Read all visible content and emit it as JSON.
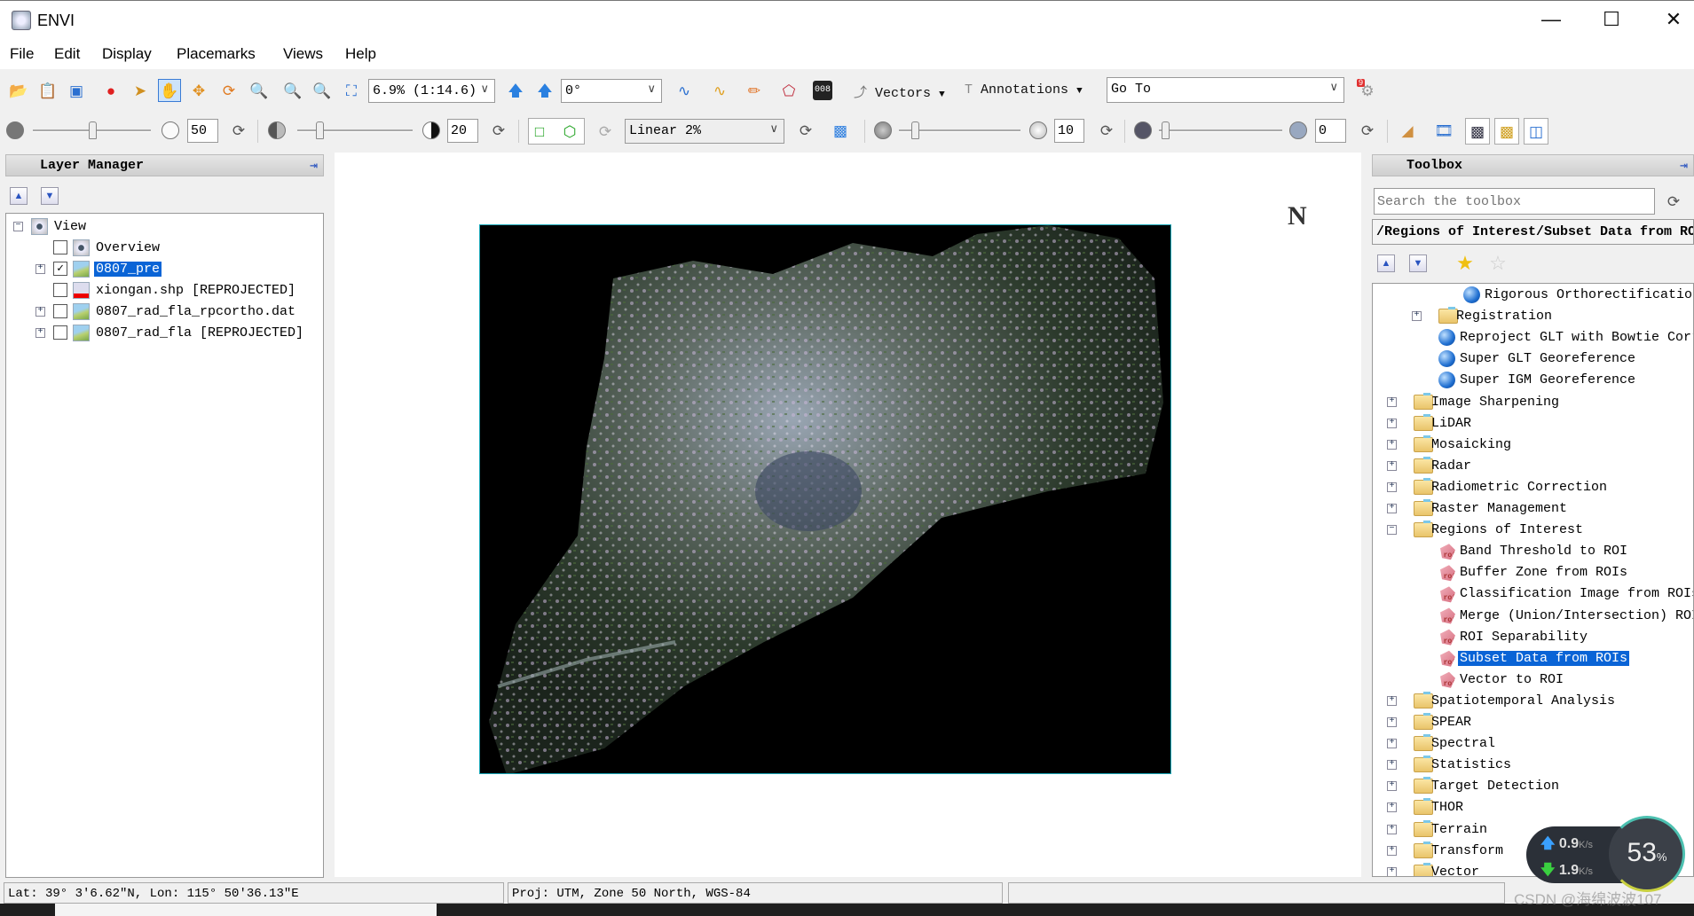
{
  "window": {
    "title": "ENVI",
    "minimize_icon": "minimize-icon",
    "maximize_icon": "maximize-icon",
    "close_icon": "close-icon"
  },
  "menu": [
    "File",
    "Edit",
    "Display",
    "Placemarks",
    "Views",
    "Help"
  ],
  "toolbar1": {
    "zoom_value": "6.9% (1:14.6)",
    "rotation_value": "0°",
    "vectors_label": "Vectors",
    "annotations_label": "Annotations",
    "goto_placeholder": "Go To",
    "notification_count": "9"
  },
  "toolbar2": {
    "brightness_value": "50",
    "contrast_value": "20",
    "stretch_value": "Linear 2%",
    "sharpen_value": "10",
    "transparency_value": "0"
  },
  "layer_manager": {
    "title": "Layer Manager",
    "tree": [
      {
        "label": "View",
        "level": 0,
        "expander": "minus",
        "icon": "view",
        "checkbox": null
      },
      {
        "label": "Overview",
        "level": 1,
        "expander": null,
        "icon": "view",
        "checkbox": false
      },
      {
        "label": "0807_pre",
        "level": 1,
        "expander": "plus",
        "icon": "raster",
        "checkbox": true,
        "selected": true
      },
      {
        "label": "xiongan.shp [REPROJECTED]",
        "level": 1,
        "expander": null,
        "icon": "vector",
        "checkbox": false
      },
      {
        "label": "0807_rad_fla_rpcortho.dat",
        "level": 1,
        "expander": "plus",
        "icon": "raster",
        "checkbox": false
      },
      {
        "label": "0807_rad_fla [REPROJECTED]",
        "level": 1,
        "expander": "plus",
        "icon": "raster",
        "checkbox": false
      }
    ]
  },
  "view": {
    "north_arrow_label": "N"
  },
  "toolbox": {
    "title": "Toolbox",
    "search_placeholder": "Search the toolbox",
    "path": "/Regions of Interest/Subset Data from ROIs",
    "tree": [
      {
        "label": "Rigorous Orthorectification",
        "level": 3,
        "icon": "tool"
      },
      {
        "label": "Registration",
        "level": 2,
        "icon": "folder",
        "expander": "plus"
      },
      {
        "label": "Reproject GLT with Bowtie Correction",
        "level": 2,
        "icon": "tool"
      },
      {
        "label": "Super GLT Georeference",
        "level": 2,
        "icon": "tool"
      },
      {
        "label": "Super IGM Georeference",
        "level": 2,
        "icon": "tool"
      },
      {
        "label": "Image Sharpening",
        "level": 1,
        "icon": "folder",
        "expander": "plus"
      },
      {
        "label": "LiDAR",
        "level": 1,
        "icon": "folder",
        "expander": "plus"
      },
      {
        "label": "Mosaicking",
        "level": 1,
        "icon": "folder",
        "expander": "plus"
      },
      {
        "label": "Radar",
        "level": 1,
        "icon": "folder",
        "expander": "plus"
      },
      {
        "label": "Radiometric Correction",
        "level": 1,
        "icon": "folder",
        "expander": "plus"
      },
      {
        "label": "Raster Management",
        "level": 1,
        "icon": "folder",
        "expander": "plus"
      },
      {
        "label": "Regions of Interest",
        "level": 1,
        "icon": "folder",
        "expander": "minus"
      },
      {
        "label": "Band Threshold to ROI",
        "level": 2,
        "icon": "roi"
      },
      {
        "label": "Buffer Zone from ROIs",
        "level": 2,
        "icon": "roi"
      },
      {
        "label": "Classification Image from ROIs",
        "level": 2,
        "icon": "roi"
      },
      {
        "label": "Merge (Union/Intersection) ROIs",
        "level": 2,
        "icon": "roi"
      },
      {
        "label": "ROI Separability",
        "level": 2,
        "icon": "roi"
      },
      {
        "label": "Subset Data from ROIs",
        "level": 2,
        "icon": "roi",
        "selected": true
      },
      {
        "label": "Vector to ROI",
        "level": 2,
        "icon": "roi"
      },
      {
        "label": "Spatiotemporal Analysis",
        "level": 1,
        "icon": "folder",
        "expander": "plus"
      },
      {
        "label": "SPEAR",
        "level": 1,
        "icon": "folder",
        "expander": "plus"
      },
      {
        "label": "Spectral",
        "level": 1,
        "icon": "folder",
        "expander": "plus"
      },
      {
        "label": "Statistics",
        "level": 1,
        "icon": "folder",
        "expander": "plus"
      },
      {
        "label": "Target Detection",
        "level": 1,
        "icon": "folder",
        "expander": "plus"
      },
      {
        "label": "THOR",
        "level": 1,
        "icon": "folder",
        "expander": "plus"
      },
      {
        "label": "Terrain",
        "level": 1,
        "icon": "folder",
        "expander": "plus"
      },
      {
        "label": "Transform",
        "level": 1,
        "icon": "folder",
        "expander": "plus"
      },
      {
        "label": "Vector",
        "level": 1,
        "icon": "folder",
        "expander": "plus"
      }
    ]
  },
  "status": {
    "location": "Lat: 39° 3'6.62\"N, Lon: 115° 50'36.13\"E",
    "projection": "Proj: UTM, Zone 50 North, WGS-84"
  },
  "network_widget": {
    "upload": "0.9",
    "download": "1.9",
    "unit": "K/s",
    "percent": 53,
    "percent_label": "53",
    "percent_sign": "%"
  },
  "watermark": "CSDN @海绵波波107"
}
